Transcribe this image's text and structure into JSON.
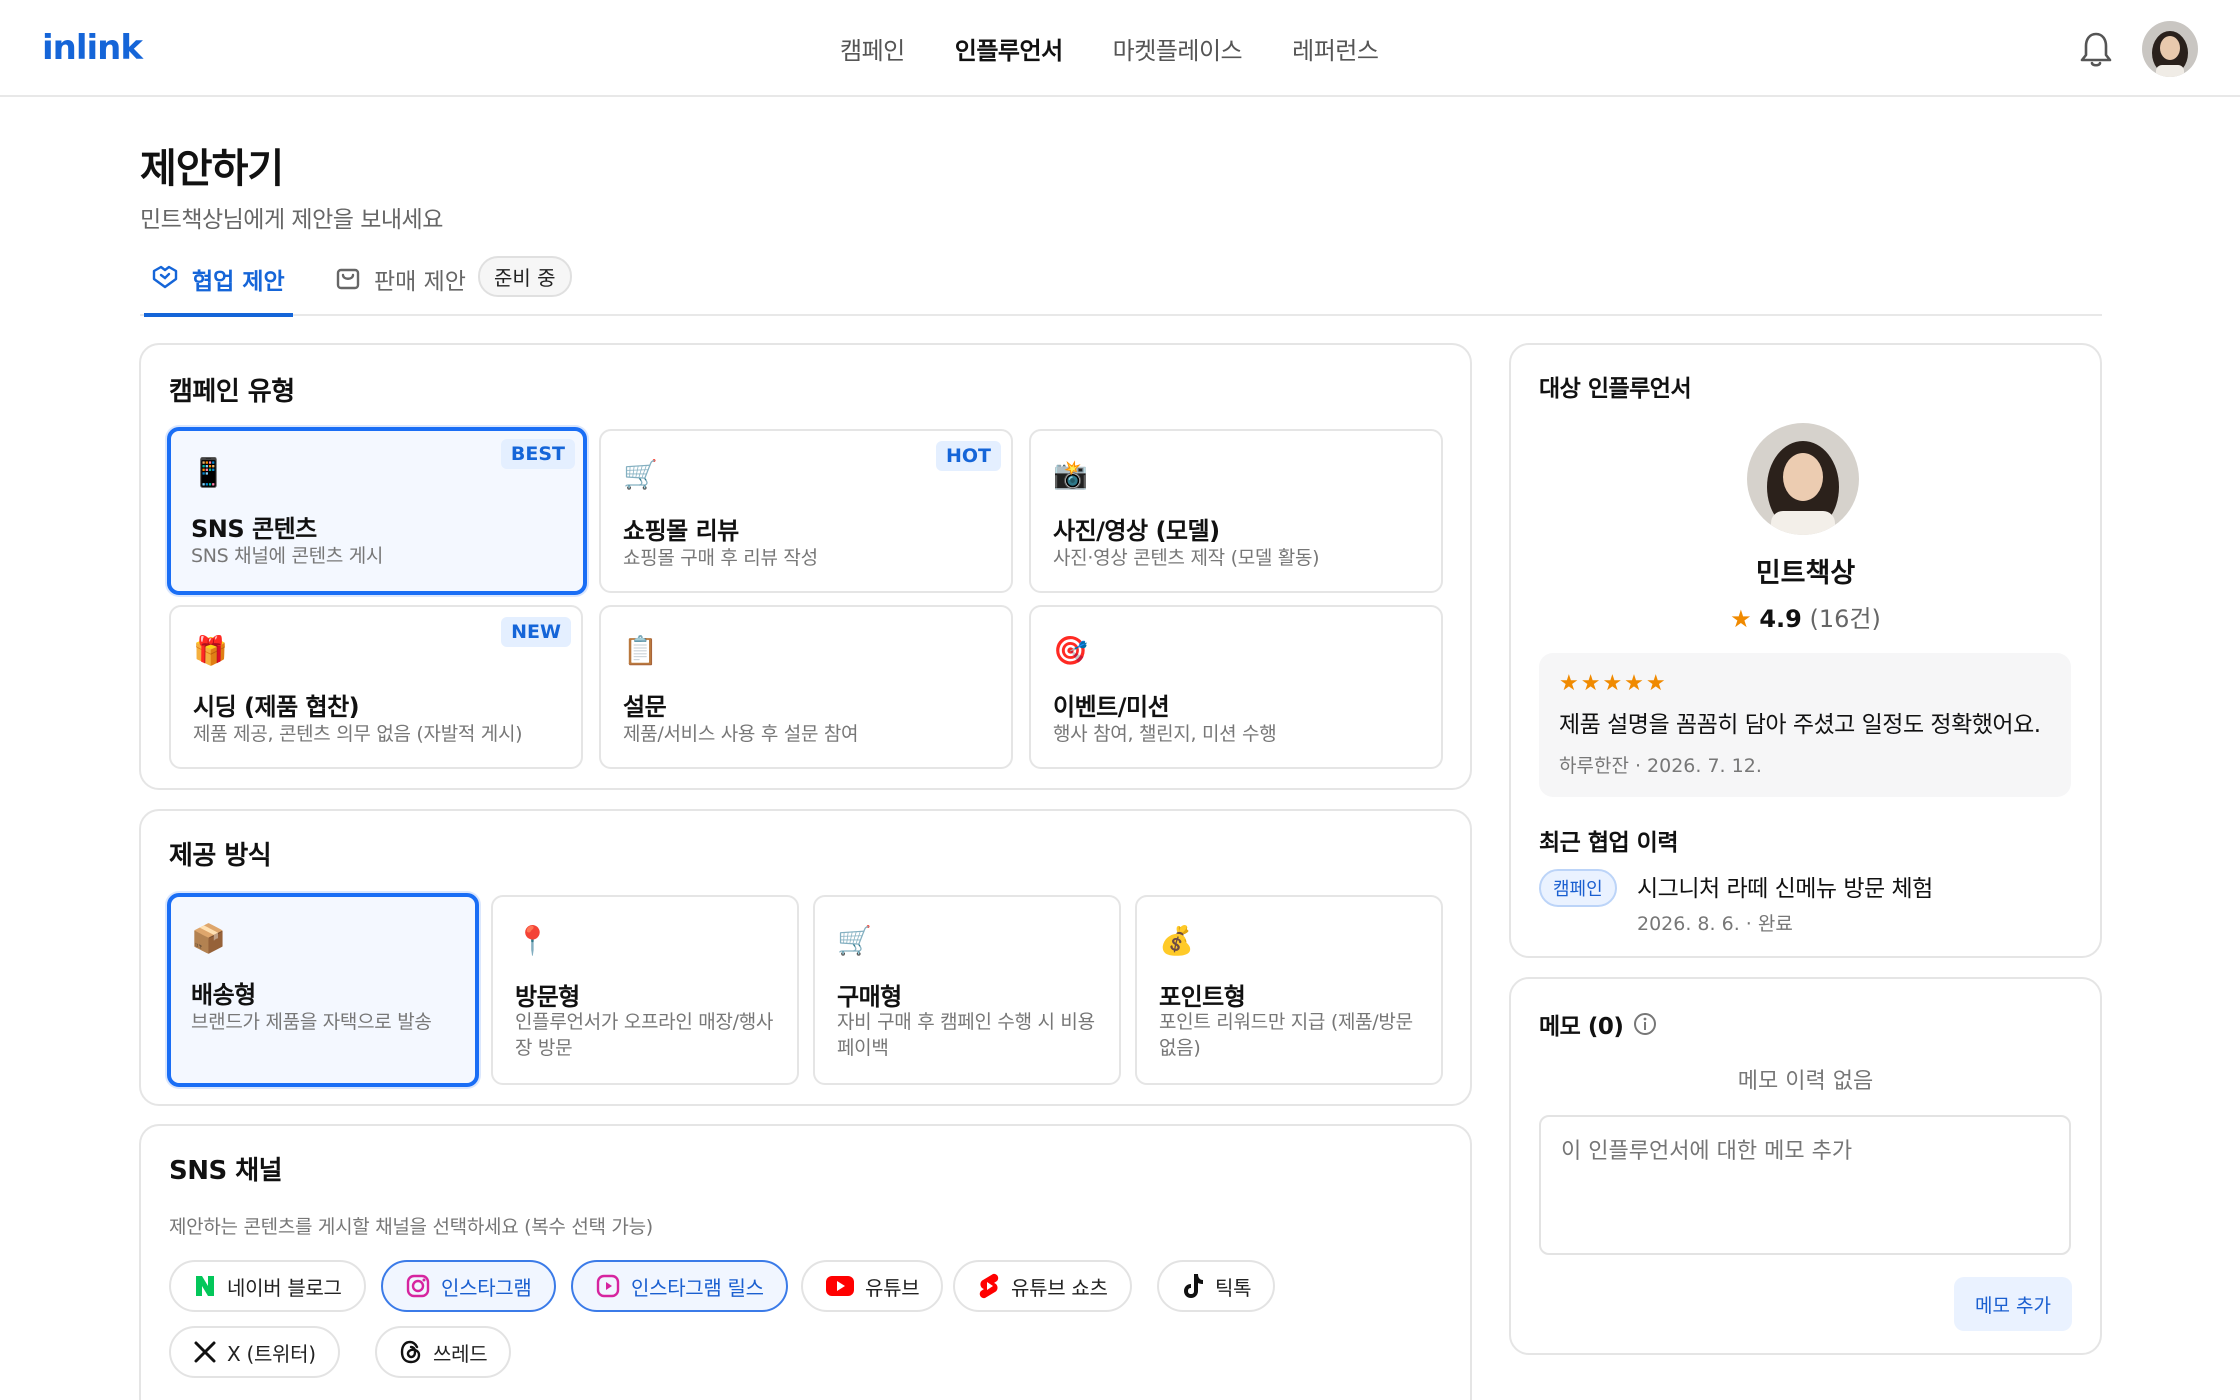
{
  "header": {
    "logo": "inlink",
    "nav": [
      "캠페인",
      "인플루언서",
      "마켓플레이스",
      "레퍼런스"
    ],
    "active_nav": "인플루언서"
  },
  "page": {
    "title": "제안하기",
    "subtitle": "민트책상님에게 제안을 보내세요",
    "tabs": [
      {
        "label": "협업 제안",
        "active": true
      },
      {
        "label": "판매 제안",
        "badge": "준비 중"
      }
    ]
  },
  "campaign_type": {
    "title": "캠페인 유형",
    "options": [
      {
        "icon": "📱",
        "title": "SNS 콘텐츠",
        "desc": "SNS 채널에 콘텐츠 게시",
        "tag": "BEST",
        "selected": true
      },
      {
        "icon": "🛒",
        "title": "쇼핑몰 리뷰",
        "desc": "쇼핑몰 구매 후 리뷰 작성",
        "tag": "HOT"
      },
      {
        "icon": "📸",
        "title": "사진/영상 (모델)",
        "desc": "사진·영상 콘텐츠 제작 (모델 활동)"
      },
      {
        "icon": "🎁",
        "title": "시딩 (제품 협찬)",
        "desc": "제품 제공, 콘텐츠 의무 없음 (자발적 게시)",
        "tag": "NEW"
      },
      {
        "icon": "📋",
        "title": "설문",
        "desc": "제품/서비스 사용 후 설문 참여"
      },
      {
        "icon": "🎯",
        "title": "이벤트/미션",
        "desc": "행사 참여, 챌린지, 미션 수행"
      }
    ]
  },
  "delivery": {
    "title": "제공 방식",
    "options": [
      {
        "icon": "📦",
        "title": "배송형",
        "desc": "브랜드가 제품을 자택으로 발송",
        "selected": true
      },
      {
        "icon": "📍",
        "title": "방문형",
        "desc": "인플루언서가 오프라인 매장/행사장 방문"
      },
      {
        "icon": "🛒",
        "title": "구매형",
        "desc": "자비 구매 후 캠페인 수행 시 비용 페이백"
      },
      {
        "icon": "💰",
        "title": "포인트형",
        "desc": "포인트 리워드만 지급 (제품/방문 없음)"
      }
    ]
  },
  "sns": {
    "title": "SNS 채널",
    "hint": "제안하는 콘텐츠를 게시할 채널을 선택하세요 (복수 선택 가능)",
    "channels": [
      {
        "icon": "naver-blog-icon",
        "label": "네이버 블로그"
      },
      {
        "icon": "instagram-icon",
        "label": "인스타그램",
        "selected": true
      },
      {
        "icon": "instagram-reels-icon",
        "label": "인스타그램 릴스",
        "selected": true
      },
      {
        "icon": "youtube-icon",
        "label": "유튜브"
      },
      {
        "icon": "youtube-shorts-icon",
        "label": "유튜브 쇼츠"
      },
      {
        "icon": "tiktok-icon",
        "label": "틱톡"
      },
      {
        "icon": "x-icon",
        "label": "X (트위터)"
      },
      {
        "icon": "threads-icon",
        "label": "쓰레드"
      }
    ]
  },
  "influencer": {
    "section_title": "대상 인플루언서",
    "name": "민트책상",
    "rating": "4.9",
    "review_count": "(16건)",
    "review": {
      "stars": "★★★★★",
      "text": "제품 설명을 꼼꼼히 담아 주셨고 일정도 정확했어요.",
      "meta": "하루한잔 · 2026. 7. 12."
    },
    "history_title": "최근 협업 이력",
    "history": {
      "badge": "캠페인",
      "title": "시그니처 라떼 신메뉴 방문 체험",
      "meta": "2026. 8. 6. · 완료"
    }
  },
  "memo": {
    "title": "메모 (0)",
    "empty": "메모 이력 없음",
    "placeholder": "이 인플루언서에 대한 메모 추가",
    "button": "메모 추가"
  },
  "colors": {
    "accent": "#1a6ef5",
    "brand": "#1565d8",
    "star": "#f08a00"
  }
}
